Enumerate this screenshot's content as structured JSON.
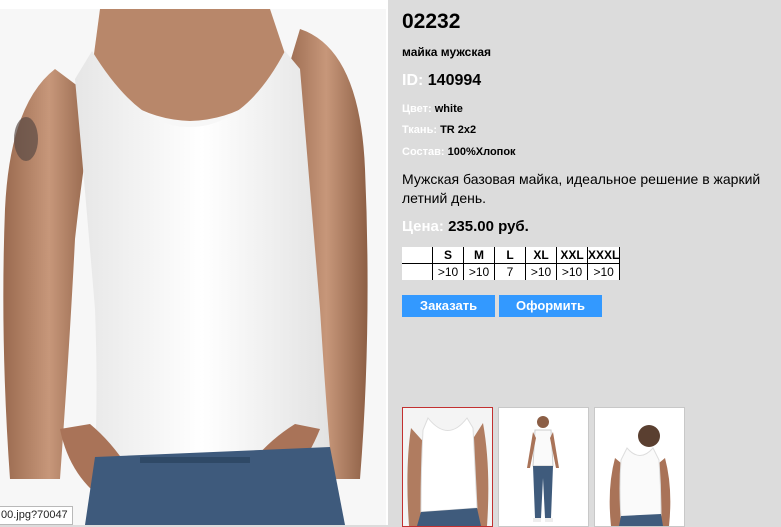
{
  "product": {
    "sku": "02232",
    "subtitle": "майка мужская",
    "id_label": "ID:",
    "id_value": "140994",
    "attributes": [
      {
        "label": "Цвет:",
        "value": "white"
      },
      {
        "label": "Ткань:",
        "value": "TR 2x2"
      },
      {
        "label": "Состав:",
        "value": "100%Хлопок"
      }
    ],
    "description": "Мужская базовая майка, идеальное решение в жаркий летний день.",
    "price_label": "Цена:",
    "price_value": "235.00 руб."
  },
  "sizes": {
    "headers": [
      "S",
      "M",
      "L",
      "XL",
      "XXL",
      "XXXL"
    ],
    "values": [
      ">10",
      ">10",
      "7",
      ">10",
      ">10",
      ">10"
    ]
  },
  "buttons": {
    "order": "Заказать",
    "checkout": "Оформить"
  },
  "status_url": "00.jpg?70047",
  "colors": {
    "accent": "#3399ff",
    "panel_bg": "#dcdcdc",
    "active_thumb_border": "#c23030"
  }
}
